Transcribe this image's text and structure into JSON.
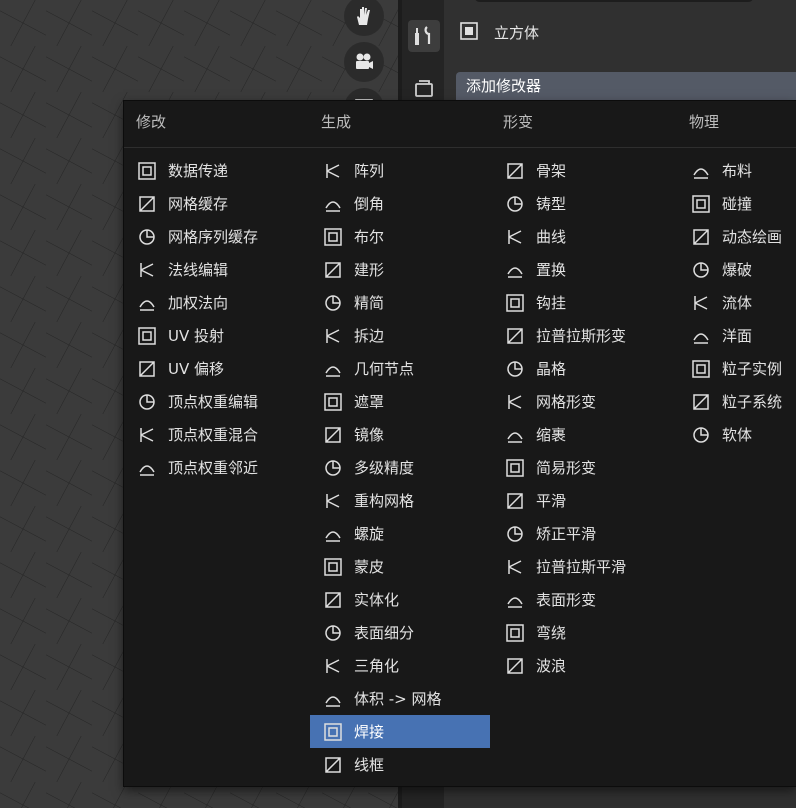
{
  "viewport_tools": [
    {
      "name": "pan-hand-icon"
    },
    {
      "name": "camera-icon"
    },
    {
      "name": "grid-icon"
    }
  ],
  "property_tabs": [
    {
      "name": "tool-icon",
      "active": true
    },
    {
      "name": "render-icon",
      "active": false
    }
  ],
  "object": {
    "name": "立方体"
  },
  "add_modifier_label": "添加修改器",
  "menu": {
    "columns": [
      {
        "header": "修改",
        "items": [
          {
            "label": "数据传递",
            "icon": "data-transfer-icon"
          },
          {
            "label": "网格缓存",
            "icon": "mesh-cache-icon"
          },
          {
            "label": "网格序列缓存",
            "icon": "mesh-sequence-cache-icon"
          },
          {
            "label": "法线编辑",
            "icon": "normal-edit-icon"
          },
          {
            "label": "加权法向",
            "icon": "weighted-normal-icon"
          },
          {
            "label": "UV 投射",
            "icon": "uv-project-icon"
          },
          {
            "label": "UV 偏移",
            "icon": "uv-warp-icon"
          },
          {
            "label": "顶点权重编辑",
            "icon": "vertex-weight-edit-icon"
          },
          {
            "label": "顶点权重混合",
            "icon": "vertex-weight-mix-icon"
          },
          {
            "label": "顶点权重邻近",
            "icon": "vertex-weight-proximity-icon"
          }
        ]
      },
      {
        "header": "生成",
        "items": [
          {
            "label": "阵列",
            "icon": "array-icon"
          },
          {
            "label": "倒角",
            "icon": "bevel-icon"
          },
          {
            "label": "布尔",
            "icon": "boolean-icon"
          },
          {
            "label": "建形",
            "icon": "build-icon"
          },
          {
            "label": "精简",
            "icon": "decimate-icon"
          },
          {
            "label": "拆边",
            "icon": "edge-split-icon"
          },
          {
            "label": "几何节点",
            "icon": "geometry-nodes-icon"
          },
          {
            "label": "遮罩",
            "icon": "mask-icon"
          },
          {
            "label": "镜像",
            "icon": "mirror-icon"
          },
          {
            "label": "多级精度",
            "icon": "multires-icon"
          },
          {
            "label": "重构网格",
            "icon": "remesh-icon"
          },
          {
            "label": "螺旋",
            "icon": "screw-icon"
          },
          {
            "label": "蒙皮",
            "icon": "skin-icon"
          },
          {
            "label": "实体化",
            "icon": "solidify-icon"
          },
          {
            "label": "表面细分",
            "icon": "subdivision-icon"
          },
          {
            "label": "三角化",
            "icon": "triangulate-icon"
          },
          {
            "label": "体积 -> 网格",
            "icon": "volume-to-mesh-icon"
          },
          {
            "label": "焊接",
            "icon": "weld-icon",
            "highlighted": true
          },
          {
            "label": "线框",
            "icon": "wireframe-icon"
          }
        ]
      },
      {
        "header": "形变",
        "items": [
          {
            "label": "骨架",
            "icon": "armature-icon"
          },
          {
            "label": "铸型",
            "icon": "cast-icon"
          },
          {
            "label": "曲线",
            "icon": "curve-icon"
          },
          {
            "label": "置换",
            "icon": "displace-icon"
          },
          {
            "label": "钩挂",
            "icon": "hook-icon"
          },
          {
            "label": "拉普拉斯形变",
            "icon": "laplacian-deform-icon"
          },
          {
            "label": "晶格",
            "icon": "lattice-icon"
          },
          {
            "label": "网格形变",
            "icon": "mesh-deform-icon"
          },
          {
            "label": "缩裹",
            "icon": "shrinkwrap-icon"
          },
          {
            "label": "简易形变",
            "icon": "simple-deform-icon"
          },
          {
            "label": "平滑",
            "icon": "smooth-icon"
          },
          {
            "label": "矫正平滑",
            "icon": "corrective-smooth-icon"
          },
          {
            "label": "拉普拉斯平滑",
            "icon": "laplacian-smooth-icon"
          },
          {
            "label": "表面形变",
            "icon": "surface-deform-icon"
          },
          {
            "label": "弯绕",
            "icon": "warp-icon"
          },
          {
            "label": "波浪",
            "icon": "wave-icon"
          }
        ]
      },
      {
        "header": "物理",
        "items": [
          {
            "label": "布料",
            "icon": "cloth-icon"
          },
          {
            "label": "碰撞",
            "icon": "collision-icon"
          },
          {
            "label": "动态绘画",
            "icon": "dynamic-paint-icon"
          },
          {
            "label": "爆破",
            "icon": "explode-icon"
          },
          {
            "label": "流体",
            "icon": "fluid-icon"
          },
          {
            "label": "洋面",
            "icon": "ocean-icon"
          },
          {
            "label": "粒子实例",
            "icon": "particle-instance-icon"
          },
          {
            "label": "粒子系统",
            "icon": "particle-system-icon"
          },
          {
            "label": "软体",
            "icon": "soft-body-icon"
          }
        ]
      }
    ]
  }
}
